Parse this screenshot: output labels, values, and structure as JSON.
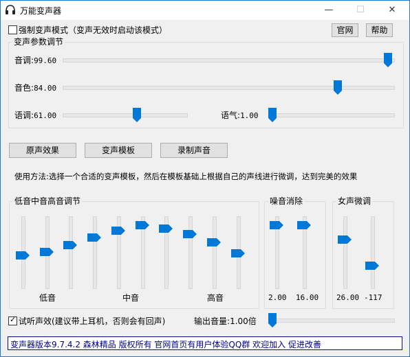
{
  "window": {
    "title": "万能变声器",
    "minimize_glyph": "—",
    "maximize_glyph": "☐",
    "close_glyph": "✕"
  },
  "top": {
    "force_mode_label": "强制变声模式（变声无效时启动该模式）",
    "force_mode_checked": false,
    "official_site_label": "官网",
    "help_label": "帮助"
  },
  "params": {
    "group_title": "变声参数调节",
    "pitch": {
      "label": "音调",
      "value": "99.60",
      "fraction": 0.996
    },
    "timbre": {
      "label": "音色",
      "value": "84.00",
      "fraction": 0.84
    },
    "speed": {
      "label": "语调",
      "value": "61.00",
      "fraction": 0.61
    },
    "breath": {
      "label": "语气",
      "value": "1.00",
      "fraction": 0.0
    }
  },
  "actions": {
    "original_label": "原声效果",
    "template_label": "变声模板",
    "record_label": "录制声音"
  },
  "usage_text": "使用方法:选择一个合适的变声模板，然后在模板基础上根据自己的声线进行微调，达到完美的效果",
  "eq": {
    "group_title": "低音中音高音调节",
    "band_levels": [
      0.45,
      0.5,
      0.61,
      0.73,
      0.84,
      0.92,
      0.87,
      0.78,
      0.65,
      0.48
    ],
    "low_label": "低音",
    "mid_label": "中音",
    "high_label": "高音"
  },
  "noise": {
    "group_title": "噪音消除",
    "sliders": [
      {
        "value": "2.00",
        "level": 0.92
      },
      {
        "value": "16.00",
        "level": 0.92
      }
    ]
  },
  "female": {
    "group_title": "女声微调",
    "sliders": [
      {
        "value": "26.00",
        "level": 0.7
      },
      {
        "value": "-117",
        "level": 0.28
      }
    ]
  },
  "bottom": {
    "monitor_label": "试听声效(建议带上耳机，否则会有回声)",
    "monitor_checked": true,
    "output_volume_label": "输出音量",
    "output_volume_value": "1.00倍",
    "output_volume_fraction": 0.0
  },
  "status": {
    "text": "变声器版本9.7.4.2  森林精品 版权所有  官网首页有用户体验QQ群 欢迎加入 促进改善"
  },
  "colors": {
    "accent": "#0078d7",
    "status_text": "#00008b",
    "window_border": "#1e78d7"
  }
}
